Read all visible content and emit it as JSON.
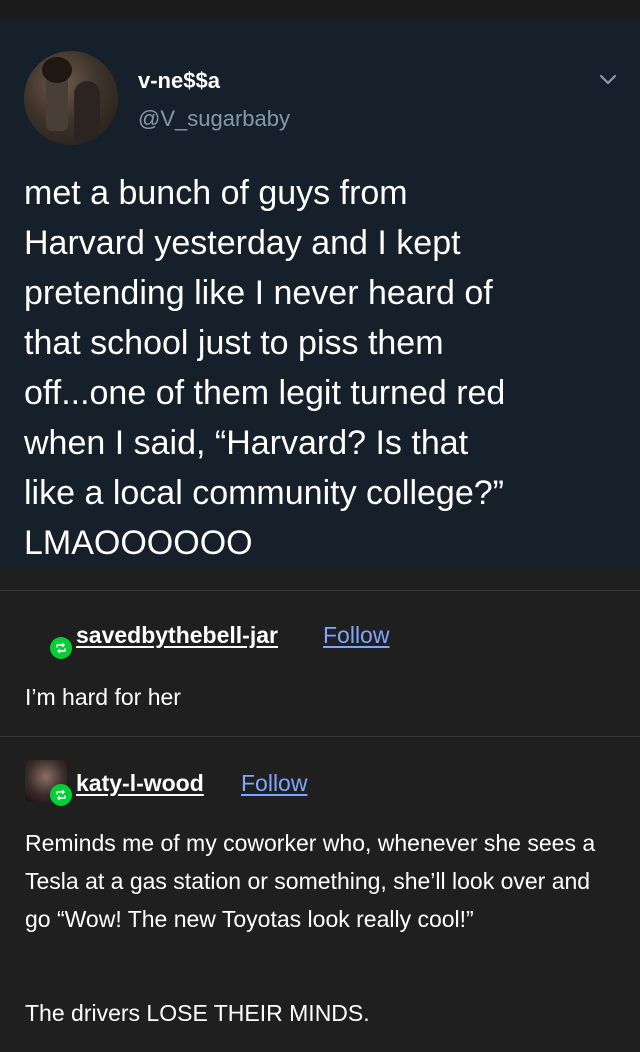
{
  "tweet": {
    "display_name": "v-ne$$a",
    "handle": "@V_sugarbaby",
    "text": "met a bunch of guys from\nHarvard yesterday and I kept\npretending like I never heard of\nthat school just to piss them\noff...one of them legit turned red\nwhen I said, “Harvard? Is that\nlike a local community college?”\nLMAOOOOOO"
  },
  "reblogs": [
    {
      "username": "savedbythebell-jar",
      "follow_label": "Follow",
      "text": "I’m hard for her"
    },
    {
      "username": "katy-l-wood",
      "follow_label": "Follow",
      "paragraph1": "Reminds me of my coworker who, whenever she sees a Tesla at a gas station or something, she’ll look over and go “Wow! The new Toyotas look really cool!”",
      "paragraph2": "The drivers LOSE THEIR MINDS."
    }
  ],
  "colors": {
    "tweet_bg": "#15202b",
    "page_bg": "#1f1f1f",
    "follow_link": "#7ea6ff",
    "reblog_green": "#00cf35",
    "handle_gray": "#8899a6"
  },
  "icons": [
    "chevron-down-icon",
    "reblog-icon",
    "avatar"
  ]
}
